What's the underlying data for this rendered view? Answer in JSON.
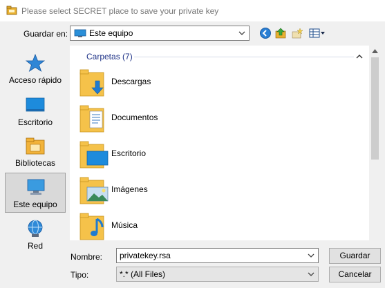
{
  "window": {
    "title": "Please select SECRET place to save your private key"
  },
  "toolbar": {
    "look_in_label": "Guardar en:",
    "look_in_value": "Este equipo"
  },
  "places": [
    {
      "label": "Acceso rápido",
      "icon": "quick-access-star-icon"
    },
    {
      "label": "Escritorio",
      "icon": "desktop-icon"
    },
    {
      "label": "Bibliotecas",
      "icon": "libraries-icon"
    },
    {
      "label": "Este equipo",
      "icon": "this-pc-icon",
      "selected": true
    },
    {
      "label": "Red",
      "icon": "network-icon"
    }
  ],
  "filelist": {
    "group_header": "Carpetas (7)",
    "items": [
      {
        "name": "Descargas",
        "icon": "downloads-folder-icon"
      },
      {
        "name": "Documentos",
        "icon": "documents-folder-icon"
      },
      {
        "name": "Escritorio",
        "icon": "desktop-folder-icon"
      },
      {
        "name": "Imágenes",
        "icon": "pictures-folder-icon"
      },
      {
        "name": "Música",
        "icon": "music-folder-icon"
      }
    ]
  },
  "filename": {
    "label": "Nombre:",
    "value": "privatekey.rsa"
  },
  "filetype": {
    "label": "Tipo:",
    "value": "*.* (All Files)"
  },
  "buttons": {
    "save": "Guardar",
    "cancel": "Cancelar"
  },
  "colors": {
    "accent": "#1e3287",
    "folder": "#f5c24a",
    "selection": "#d9d9d9"
  }
}
